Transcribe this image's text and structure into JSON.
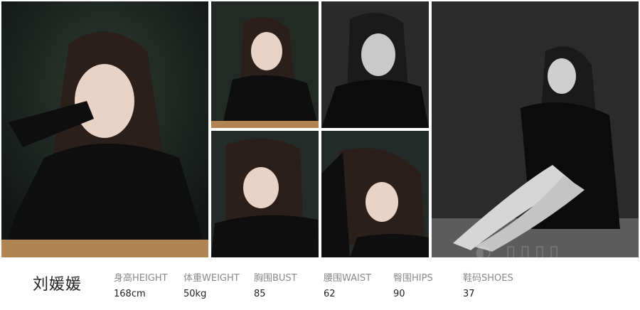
{
  "model": {
    "name": "刘媛媛"
  },
  "stats": [
    {
      "label": "身高HEIGHT",
      "value": "168cm"
    },
    {
      "label": "体重WEIGHT",
      "value": "50kg"
    },
    {
      "label": "胸围BUST",
      "value": "85"
    },
    {
      "label": "腰围WAIST",
      "value": "62"
    },
    {
      "label": "臀围HIPS",
      "value": "90"
    },
    {
      "label": "鞋码SHOES",
      "value": "37"
    }
  ],
  "colors": {
    "backdrop": "#1f1f1f",
    "sweater": "#0e0e0e",
    "hair": "#2a1f1b",
    "skin": "#e9d3c7",
    "table": "#b08453"
  }
}
